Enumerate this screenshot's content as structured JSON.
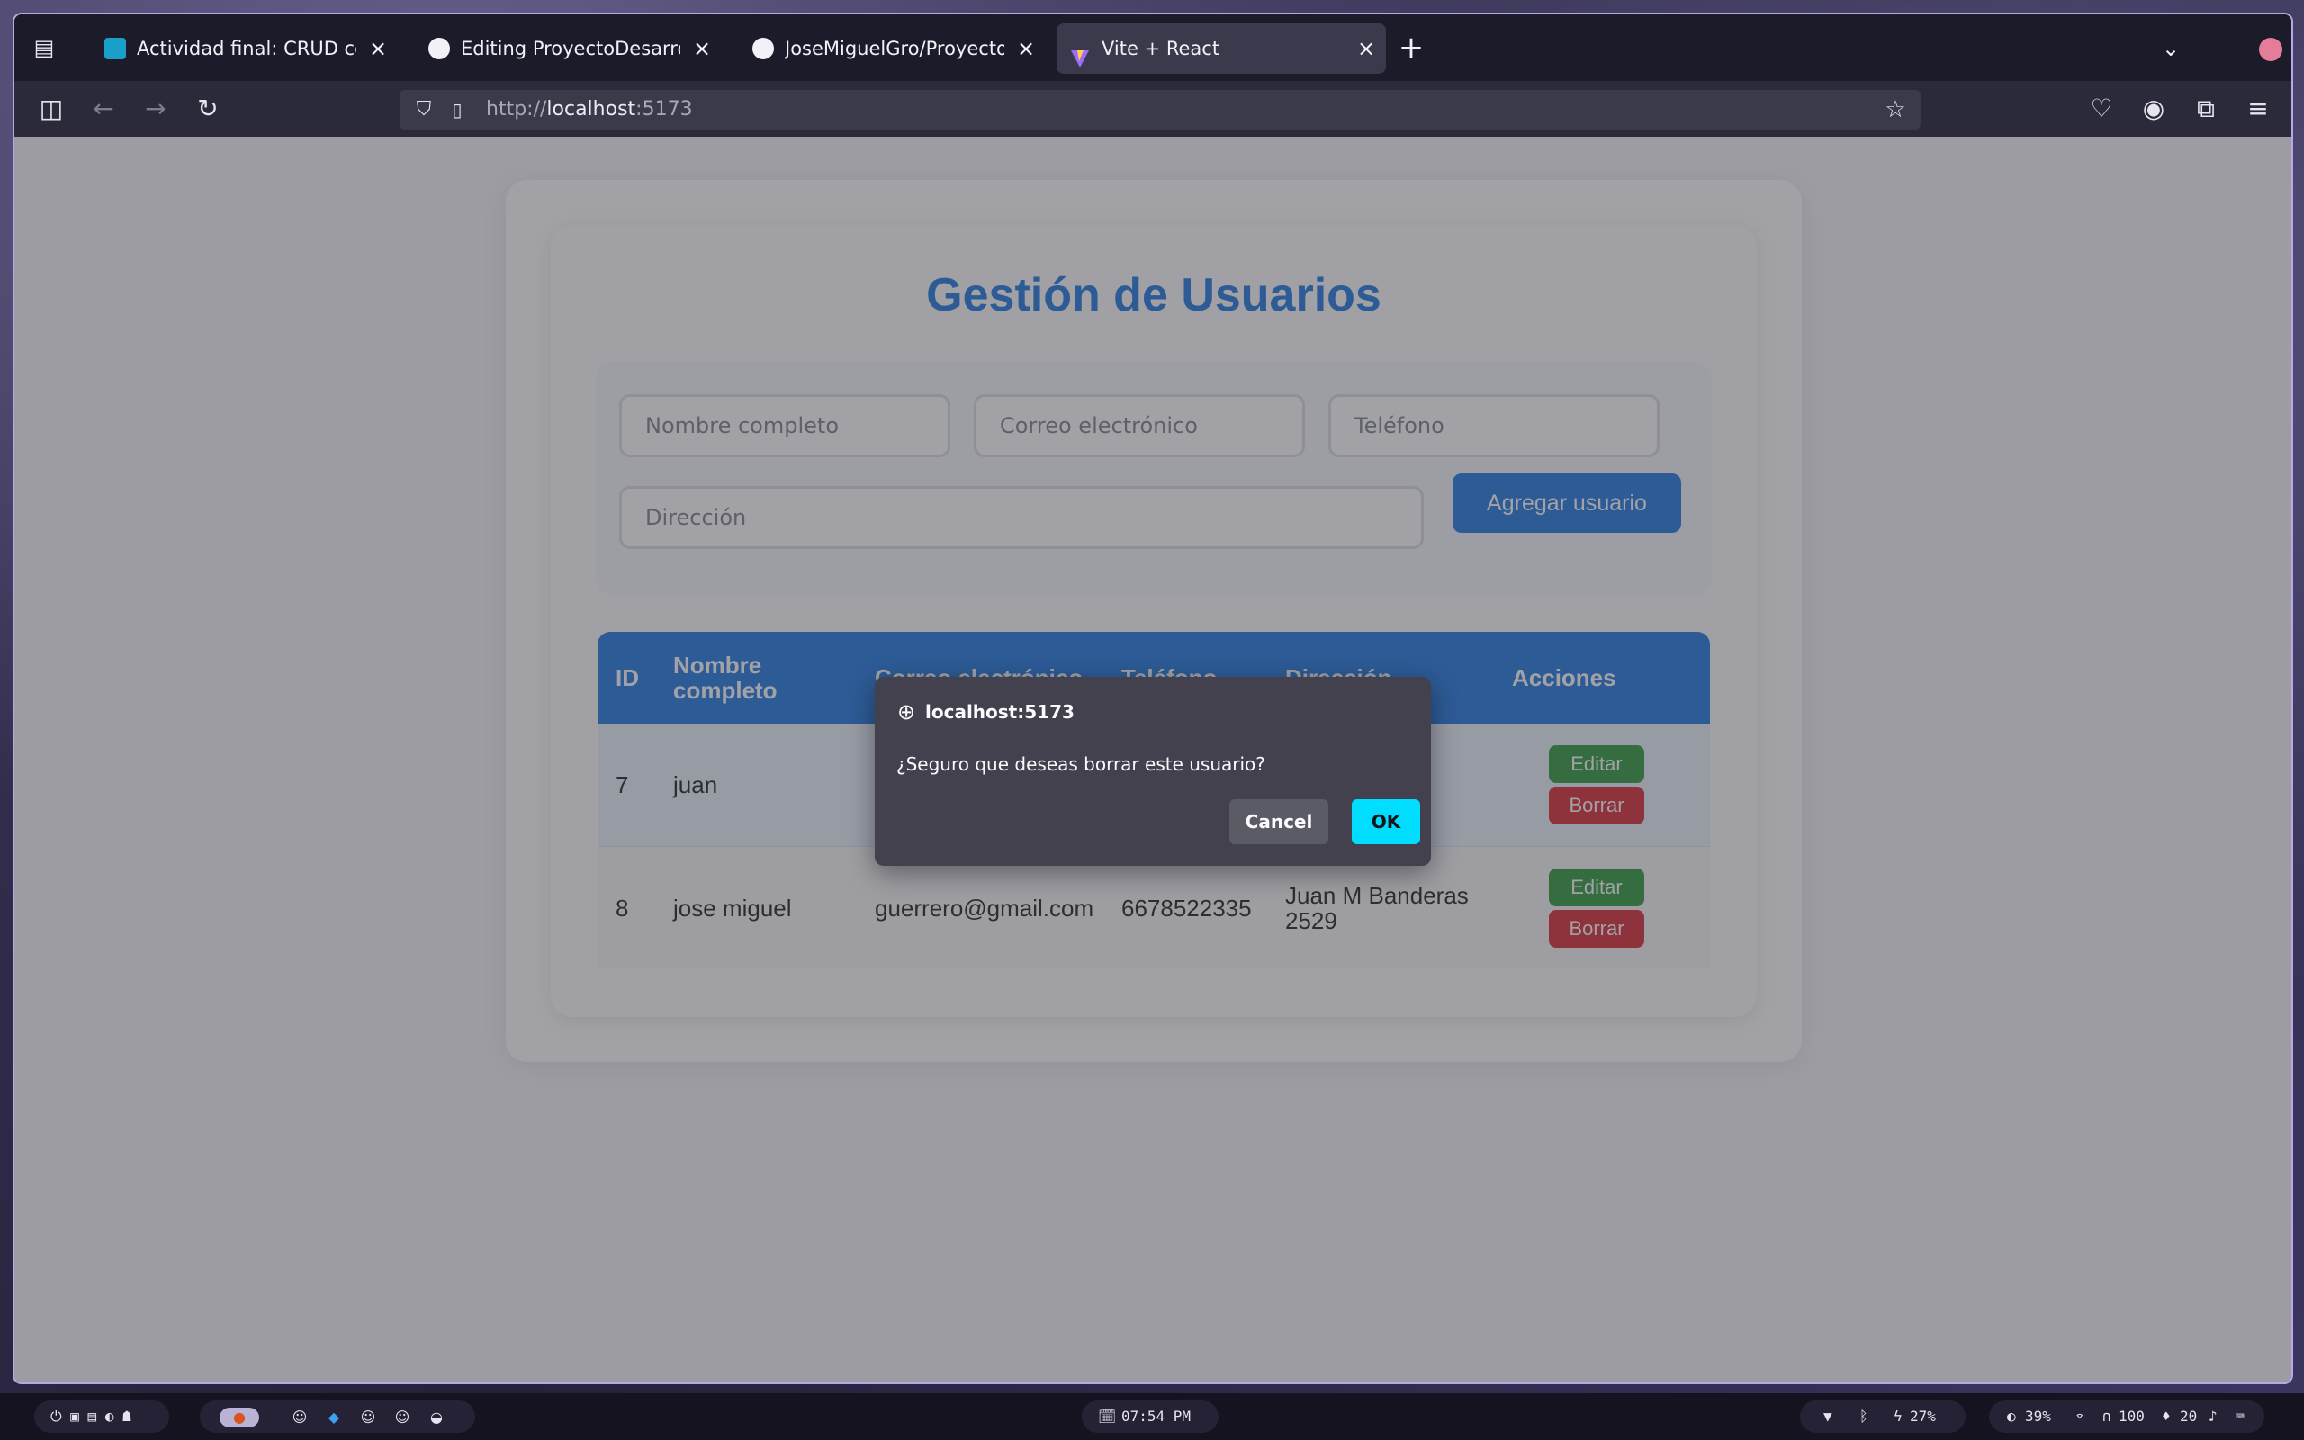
{
  "browser": {
    "tabs": [
      {
        "title": "Actividad final: CRUD completo",
        "favicon": "classroom-icon",
        "active": false
      },
      {
        "title": "Editing ProyectoDesarrolloWeb",
        "favicon": "github-icon",
        "active": false
      },
      {
        "title": "JoseMiguelGro/ProyectoDesarrollo",
        "favicon": "github-icon",
        "active": false
      },
      {
        "title": "Vite + React",
        "favicon": "vite-icon",
        "active": true
      }
    ],
    "url_prefix": "http://",
    "url_host": "localhost",
    "url_port": ":5173"
  },
  "app": {
    "title": "Gestión de Usuarios",
    "form": {
      "name_placeholder": "Nombre completo",
      "email_placeholder": "Correo electrónico",
      "phone_placeholder": "Teléfono",
      "address_placeholder": "Dirección",
      "add_button": "Agregar usuario"
    },
    "table": {
      "headers": [
        "ID",
        "Nombre completo",
        "Correo electrónico",
        "Teléfono",
        "Dirección",
        "Acciones"
      ],
      "rows": [
        {
          "id": "7",
          "name": "juan",
          "email": "",
          "phone": "",
          "address": ""
        },
        {
          "id": "8",
          "name": "jose miguel",
          "email": "guerrero@gmail.com",
          "phone": "6678522335",
          "address": "Juan M Banderas 2529"
        }
      ],
      "edit_label": "Editar",
      "delete_label": "Borrar"
    }
  },
  "dialog": {
    "origin": "localhost:5173",
    "message": "¿Seguro que deseas borrar este usuario?",
    "cancel": "Cancel",
    "ok": "OK"
  },
  "taskbar": {
    "clock": "07:54 PM",
    "battery": "27%",
    "brightness": "39%",
    "headphones": "100",
    "mic": "20"
  },
  "colors": {
    "accent": "#1f78e0",
    "edit": "#2e9a3e",
    "delete": "#d82a35",
    "dialog_ok": "#00ddff"
  }
}
